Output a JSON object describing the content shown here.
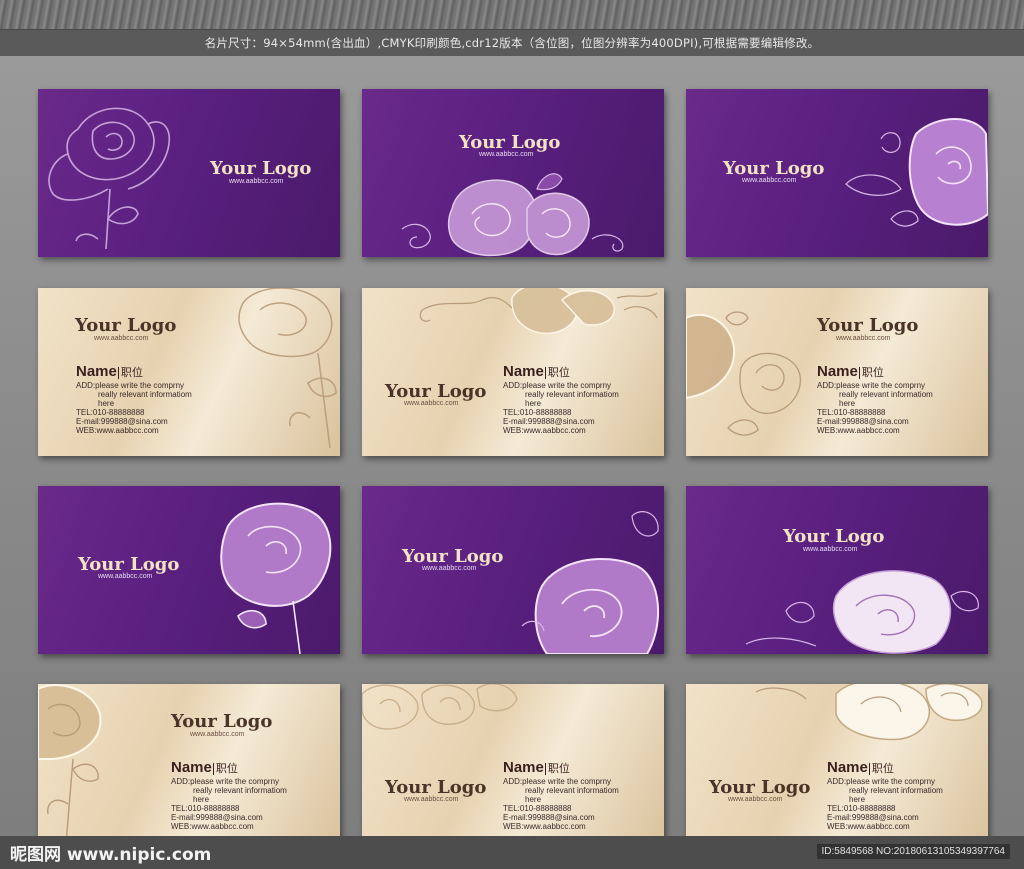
{
  "header": {
    "spec_text": "名片尺寸：94×54mm(含出血）,CMYK印刷颜色,cdr12版本（含位图，位图分辨率为400DPI),可根据需要编辑修改。"
  },
  "cards": [
    {
      "style": "purple",
      "logo": "Your Logo",
      "url": "www.aabbcc.com"
    },
    {
      "style": "purple",
      "logo": "Your Logo",
      "url": "www.aabbcc.com"
    },
    {
      "style": "purple",
      "logo": "Your Logo",
      "url": "www.aabbcc.com"
    },
    {
      "style": "gold",
      "logo": "Your Logo",
      "url": "www.aabbcc.com",
      "name": "Name",
      "title": "职位",
      "add_line1": "ADD:please write the comprny",
      "add_line2": "really relevant informatiom",
      "add_line3": "here",
      "tel": "TEL:010-88888888",
      "email": "E-mail:999888@sina.com",
      "web": "WEB:www.aabbcc.com"
    },
    {
      "style": "gold",
      "logo": "Your Logo",
      "url": "www.aabbcc.com",
      "name": "Name",
      "title": "职位",
      "add_line1": "ADD:please write the comprny",
      "add_line2": "really relevant informatiom",
      "add_line3": "here",
      "tel": "TEL:010-88888888",
      "email": "E-mail:999888@sina.com",
      "web": "WEB:www.aabbcc.com"
    },
    {
      "style": "gold",
      "logo": "Your Logo",
      "url": "www.aabbcc.com",
      "name": "Name",
      "title": "职位",
      "add_line1": "ADD:please write the comprny",
      "add_line2": "really relevant informatiom",
      "add_line3": "here",
      "tel": "TEL:010-88888888",
      "email": "E-mail:999888@sina.com",
      "web": "WEB:www.aabbcc.com"
    },
    {
      "style": "purple",
      "logo": "Your Logo",
      "url": "www.aabbcc.com"
    },
    {
      "style": "purple",
      "logo": "Your Logo",
      "url": "www.aabbcc.com"
    },
    {
      "style": "purple",
      "logo": "Your Logo",
      "url": "www.aabbcc.com"
    },
    {
      "style": "gold",
      "logo": "Your Logo",
      "url": "www.aabbcc.com",
      "name": "Name",
      "title": "职位",
      "add_line1": "ADD:please write the comprny",
      "add_line2": "really relevant informatiom",
      "add_line3": "here",
      "tel": "TEL:010-88888888",
      "email": "E-mail:999888@sina.com",
      "web": "WEB:www.aabbcc.com"
    },
    {
      "style": "gold",
      "logo": "Your Logo",
      "url": "www.aabbcc.com",
      "name": "Name",
      "title": "职位",
      "add_line1": "ADD:please write the comprny",
      "add_line2": "really relevant informatiom",
      "add_line3": "here",
      "tel": "TEL:010-88888888",
      "email": "E-mail:999888@sina.com",
      "web": "WEB:www.aabbcc.com"
    },
    {
      "style": "gold",
      "logo": "Your Logo",
      "url": "www.aabbcc.com",
      "name": "Name",
      "title": "职位",
      "add_line1": "ADD:please write the comprny",
      "add_line2": "really relevant informatiom",
      "add_line3": "here",
      "tel": "TEL:010-88888888",
      "email": "E-mail:999888@sina.com",
      "web": "WEB:www.aabbcc.com"
    }
  ],
  "watermark": {
    "site": "昵图网 www.nipic.com",
    "id": "ID:5849568 NO:20180613105349397764"
  },
  "colors": {
    "purple_card": "#5a2080",
    "gold_card": "#e6d2b0",
    "rose_purple": "#b07ac8",
    "rose_gold": "#c8ad88"
  }
}
